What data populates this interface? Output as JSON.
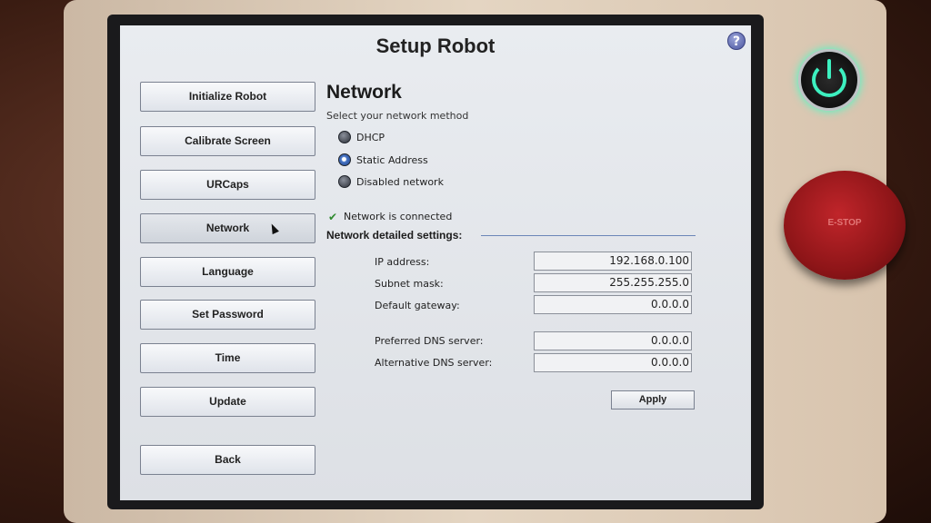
{
  "window": {
    "title": "Setup Robot",
    "help_icon": "?"
  },
  "sidebar": {
    "items": [
      {
        "label": "Initialize Robot"
      },
      {
        "label": "Calibrate Screen"
      },
      {
        "label": "URCaps"
      },
      {
        "label": "Network"
      },
      {
        "label": "Language"
      },
      {
        "label": "Set Password"
      },
      {
        "label": "Time"
      },
      {
        "label": "Update"
      }
    ],
    "active": "Network",
    "back_label": "Back"
  },
  "main": {
    "heading": "Network",
    "subtext": "Select your network method",
    "methods": [
      {
        "label": "DHCP",
        "selected": false
      },
      {
        "label": "Static Address",
        "selected": true
      },
      {
        "label": "Disabled network",
        "selected": false
      }
    ],
    "status": "Network is connected",
    "section_title": "Network detailed settings:",
    "fields": {
      "ip": {
        "label": "IP address:",
        "value": "192.168.0.100"
      },
      "subnet": {
        "label": "Subnet mask:",
        "value": "255.255.255.0"
      },
      "gateway": {
        "label": "Default gateway:",
        "value": "0.0.0.0"
      },
      "dns1": {
        "label": "Preferred DNS server:",
        "value": "0.0.0.0"
      },
      "dns2": {
        "label": "Alternative DNS server:",
        "value": "0.0.0.0"
      }
    },
    "apply_label": "Apply"
  },
  "hardware": {
    "estop_label": "E-STOP",
    "power_icon": "power-icon"
  },
  "colors": {
    "status_ok": "#2f8a2f",
    "power_glow": "#3df0c0",
    "estop_red": "#c0252a"
  }
}
